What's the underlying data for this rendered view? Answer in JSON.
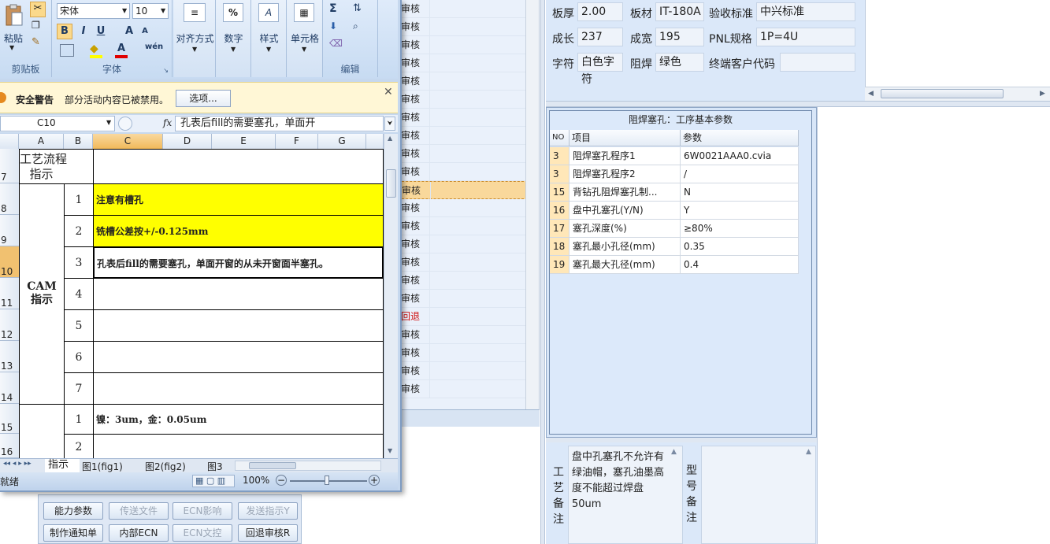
{
  "bg_list": {
    "rows": [
      "审核",
      "审核",
      "审核",
      "审核",
      "审核",
      "审核",
      "审核",
      "审核",
      "审核",
      "审核",
      "审核",
      "审核",
      "审核",
      "审核",
      "审核",
      "审核",
      "审核",
      "回退",
      "审核",
      "审核",
      "审核",
      "审核"
    ],
    "rows_display": [
      "审核",
      "审核",
      "审核",
      "审核",
      "审核",
      "审核",
      "审核",
      "审核",
      "审核",
      "审核",
      "审核",
      "审核",
      "审核",
      "审核",
      "审核",
      "审核",
      "审核",
      "回退",
      "审核",
      "审核",
      "审核",
      "审核"
    ]
  },
  "bottom_buttons": {
    "row1": [
      "能力参数",
      "传送文件",
      "ECN影响",
      "发送指示Y"
    ],
    "row2": [
      "制作通知单",
      "内部ECN",
      "ECN文控",
      "回退审核R"
    ]
  },
  "info": {
    "thickness_label": "板厚",
    "thickness": "2.00",
    "material_label": "板材",
    "material": "IT-180A",
    "standard_label": "验收标准",
    "standard": "中兴标准",
    "length_label": "成长",
    "length": "237",
    "width_label": "成宽",
    "width": "195",
    "pnl_label": "PNL规格",
    "pnl": "1P=4U",
    "char_label": "字符",
    "char": "白色字符",
    "solder_label": "阻焊",
    "solder": "绿色",
    "cust_label": "终端客户代码",
    "cust": ""
  },
  "param_grid": {
    "title": "阻焊塞孔：工序基本参数",
    "headers": [
      "NO",
      "项目",
      "参数"
    ],
    "rows": [
      {
        "no": "3",
        "item": "阻焊塞孔程序1",
        "value": "6W0021AAA0.cvia"
      },
      {
        "no": "3",
        "item": "阻焊塞孔程序2",
        "value": "/"
      },
      {
        "no": "15",
        "item": "背钻孔阻焊塞孔制...",
        "value": "N"
      },
      {
        "no": "16",
        "item": "盘中孔塞孔(Y/N)",
        "value": "Y"
      },
      {
        "no": "17",
        "item": "塞孔深度(%)",
        "value": "≥80%"
      },
      {
        "no": "18",
        "item": "塞孔最小孔径(mm)",
        "value": "0.35"
      },
      {
        "no": "19",
        "item": "塞孔最大孔径(mm)",
        "value": "0.4"
      }
    ]
  },
  "remarks": {
    "process_label": "工艺备注",
    "process_text": "盘中孔塞孔不允许有绿油帽，塞孔油墨高度不能超过焊盘50um",
    "model_label": "型号备注",
    "model_text": ""
  },
  "excel": {
    "ribbon": {
      "paste": "粘贴",
      "clipboard": "剪贴板",
      "font_name": "宋体",
      "font_size": "10",
      "font_group": "字体",
      "align": "对齐方式",
      "number": "数字",
      "style": "样式",
      "cells": "单元格",
      "edit": "编辑",
      "bold": "B",
      "italic": "I",
      "underline": "U",
      "grow": "A",
      "shrink": "A",
      "fontcolor": "A",
      "phonetic": "wén",
      "sigma": "Σ",
      "pct": "%"
    },
    "security": {
      "title": "安全警告",
      "text": "部分活动内容已被禁用。",
      "button": "选项..."
    },
    "name_box": "C10",
    "fx": "fx",
    "formula": "孔表后fill的需要塞孔，单面开",
    "columns": [
      "A",
      "B",
      "C",
      "D",
      "E",
      "F",
      "G"
    ],
    "row_numbers": [
      "7",
      "8",
      "9",
      "10",
      "11",
      "12",
      "13",
      "14",
      "15",
      "16"
    ],
    "a7": "工艺流程\n指示",
    "a_cam": "CAM\n指示",
    "b_values": [
      "1",
      "2",
      "3",
      "4",
      "5",
      "6",
      "7",
      "1",
      "2"
    ],
    "c_values": [
      "注意有槽孔",
      "铣槽公差按+/-0.125mm",
      "孔表后fill的需要塞孔，单面开窗的从未开窗面半塞孔。",
      "",
      "",
      "",
      "",
      "镍：3um，金：0.05um",
      ""
    ],
    "sheet_tabs": [
      "指示",
      "图1(fig1)",
      "图2(fig2)",
      "图3"
    ],
    "status": "就绪",
    "zoom": "100%"
  },
  "colors": {
    "highlight_yellow": "#ffff00",
    "selected_row": "#f9d89b",
    "grid_no_bg": "#ffe7b8",
    "panel_blue": "#dbe8f9"
  }
}
